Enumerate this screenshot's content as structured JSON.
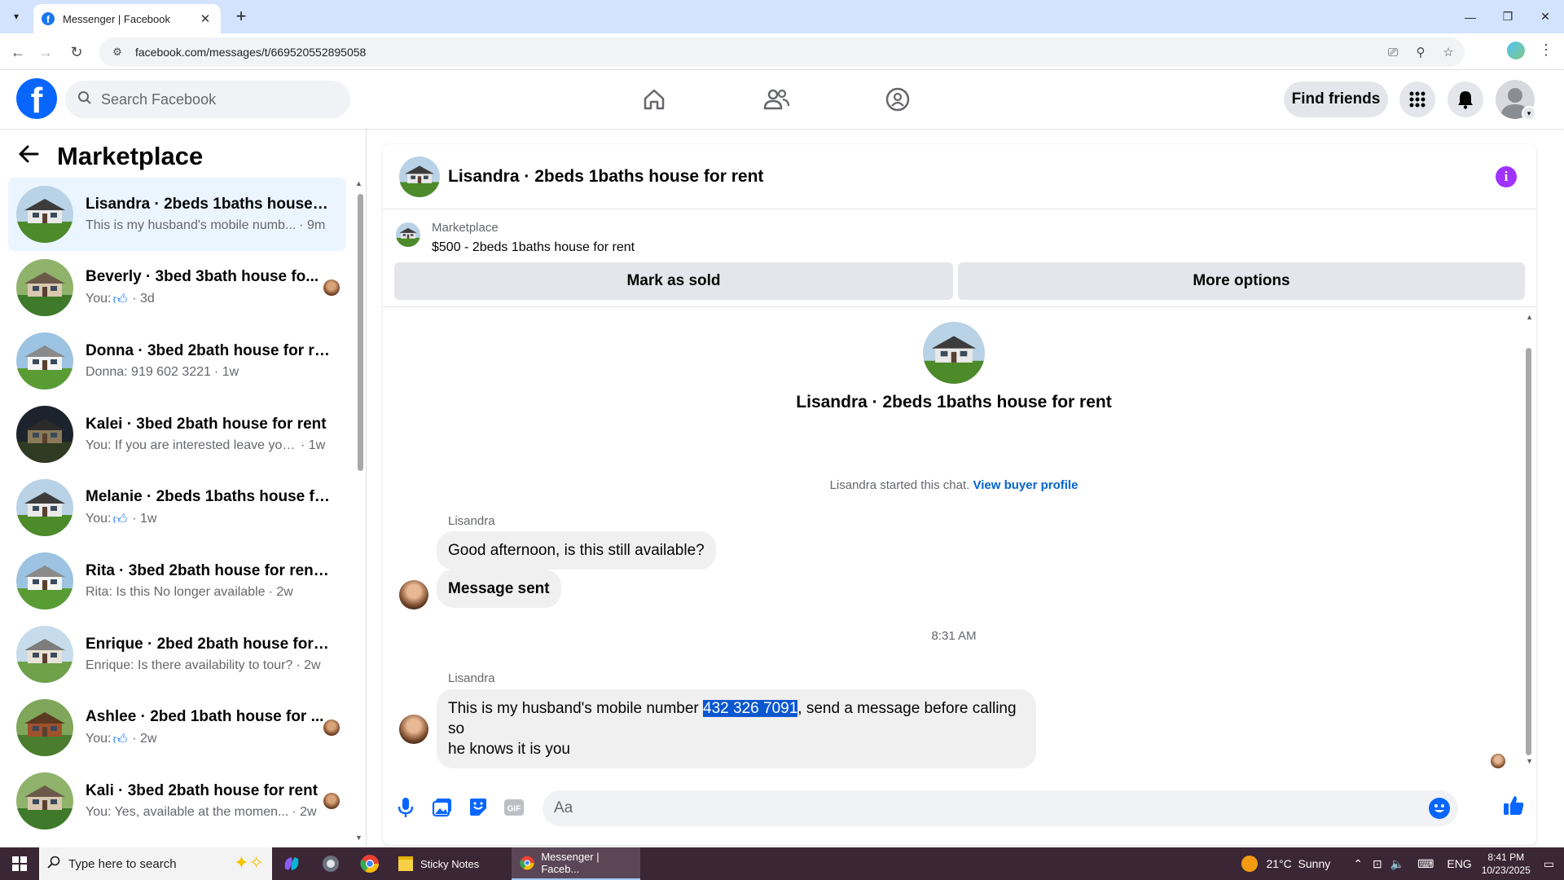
{
  "browser": {
    "tab_title": "Messenger | Facebook",
    "url": "facebook.com/messages/t/669520552895058"
  },
  "header": {
    "search_placeholder": "Search Facebook",
    "find_friends_label": "Find friends"
  },
  "sidebar": {
    "title": "Marketplace",
    "conversations": [
      {
        "name": "Lisandra · 2beds 1baths house fo...",
        "preview": "This is my husband's mobile numb...",
        "time": "· 9m",
        "active": true,
        "thumbnail": "house-gray"
      },
      {
        "name": "Beverly · 3bed 3bath house fo...",
        "preview_prefix": "You:",
        "preview": "",
        "time": "· 3d",
        "thumb_icon": "thumbs-up-icon",
        "thumbnail": "house-garden"
      },
      {
        "name": "Donna · 3bed 2bath house for re...",
        "preview": "Donna: 919 602 3221",
        "time": "· 1w",
        "thumbnail": "house-white"
      },
      {
        "name": "Kalei · 3bed 2bath house for rent",
        "preview": "You: If you are interested leave your...",
        "time": "· 1w",
        "thumbnail": "house-night"
      },
      {
        "name": "Melanie · 2beds 1baths house for...",
        "preview_prefix": "You:",
        "preview": "",
        "time": "· 1w",
        "thumb_icon": "thumbs-up-icon",
        "thumbnail": "house-gray"
      },
      {
        "name": "Rita · 3bed 2bath house for rent ...",
        "preview": "Rita: Is this No longer available",
        "time": "· 2w",
        "thumbnail": "house-white"
      },
      {
        "name": "Enrique · 2bed 2bath house for r...",
        "preview": "Enrique: Is there availability to tour?",
        "time": "· 2w",
        "thumbnail": "house-beige"
      },
      {
        "name": "Ashlee · 2bed 1bath house for ...",
        "preview_prefix": "You:",
        "preview": "",
        "time": "· 2w",
        "thumb_icon": "thumbs-up-icon",
        "thumbnail": "house-brick"
      },
      {
        "name": "Kali · 3bed 2bath house for rent",
        "preview": "You: Yes, available at the momen...",
        "time": "· 2w",
        "thumbnail": "house-garden"
      }
    ]
  },
  "chat": {
    "title": "Lisandra · 2beds 1baths house for rent",
    "listing_label": "Marketplace",
    "listing_detail": "$500 - 2beds 1baths house for rent",
    "mark_sold_label": "Mark as sold",
    "more_options_label": "More options",
    "intro_title": "Lisandra · 2beds 1baths house for rent",
    "started_text": "Lisandra started this chat.",
    "buyer_profile_link": "View buyer profile",
    "messages": [
      {
        "sender": "Lisandra",
        "text": "Good afternoon, is this still available?"
      },
      {
        "text": "Message sent",
        "bold": true
      },
      {
        "timestamp": "8:31 AM"
      },
      {
        "sender": "Lisandra",
        "text_before": "This is my husband's mobile number ",
        "highlight": "432 326 7091",
        "text_after": ", send a message before calling so",
        "text_line2": "he knows it is you"
      }
    ],
    "composer_placeholder": "Aa"
  },
  "taskbar": {
    "search_text": "Type here to search",
    "tasks": [
      "Sticky Notes",
      "Messenger | Faceb..."
    ],
    "weather": "21°C  Sunny",
    "lang": "ENG",
    "time": "8:41 PM",
    "date": "10/23/2025"
  },
  "colors": {
    "fb_blue": "#0866ff",
    "active_row": "#ebf5ff",
    "highlight": "#0a57d0",
    "info_purple": "#a033ff"
  }
}
